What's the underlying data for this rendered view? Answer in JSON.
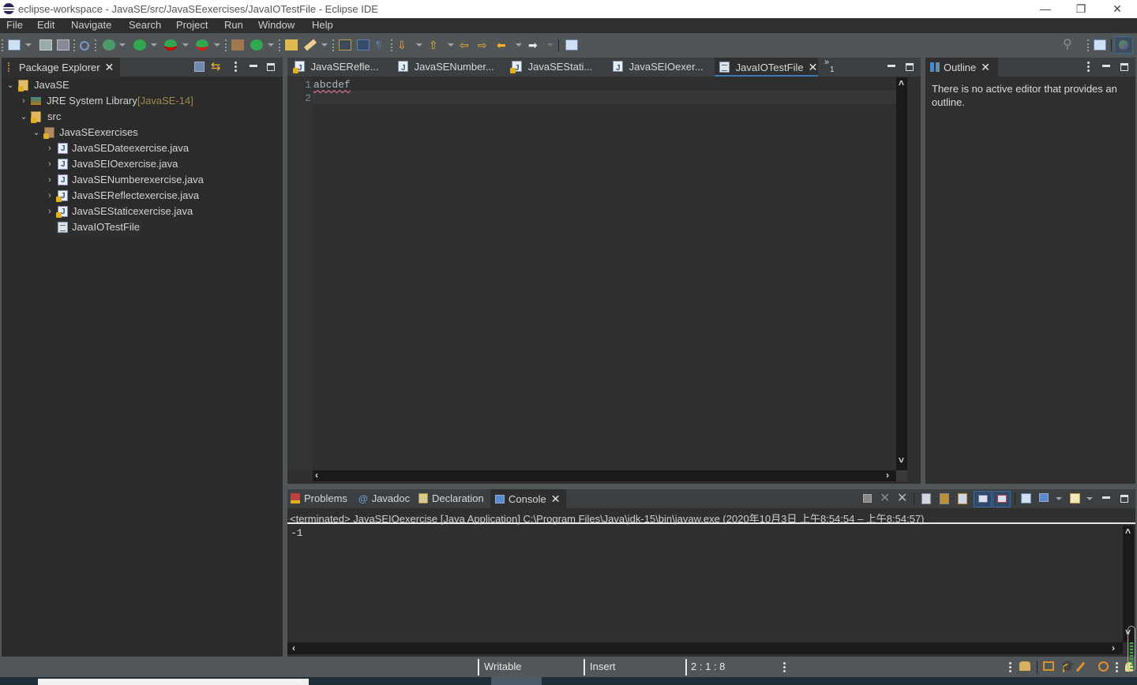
{
  "window": {
    "title": "eclipse-workspace - JavaSE/src/JavaSEexercises/JavaIOTestFile - Eclipse IDE",
    "minimize_glyph": "—",
    "restore_glyph": "❐",
    "close_glyph": "✕"
  },
  "menu": {
    "items": [
      "File",
      "Edit",
      "Navigate",
      "Search",
      "Project",
      "Run",
      "Window",
      "Help"
    ]
  },
  "toolbar": {
    "icons": [
      "new-icon",
      "save-icon",
      "save-all-icon",
      "skip-breakpoints-icon",
      "debug-icon",
      "run-icon",
      "coverage-icon",
      "external-tools-icon",
      "new-java-package-icon",
      "new-java-class-icon",
      "open-type-icon",
      "search-pencil-icon",
      "toggle-mark-occurrences-icon",
      "toggle-block-selection-icon",
      "show-whitespace-icon",
      "next-annotation-icon",
      "previous-annotation-icon",
      "last-edit-location-icon",
      "back-icon",
      "forward-icon",
      "pin-editor-icon"
    ],
    "right_icons": [
      "search-icon",
      "open-perspective-icon",
      "java-ee-perspective-icon"
    ]
  },
  "package_explorer": {
    "tab_label": "Package Explorer",
    "tree": [
      {
        "label": "JavaSE",
        "depth": 0,
        "expanded": true,
        "icon": "project-icon"
      },
      {
        "label": "JRE System Library",
        "suffix": "[JavaSE-14]",
        "depth": 1,
        "expanded": false,
        "icon": "library-icon"
      },
      {
        "label": "src",
        "depth": 1,
        "expanded": true,
        "icon": "source-folder-icon"
      },
      {
        "label": "JavaSEexercises",
        "depth": 2,
        "expanded": true,
        "icon": "package-icon"
      },
      {
        "label": "JavaSEDateexercise.java",
        "depth": 3,
        "expanded": false,
        "icon": "java-file-icon",
        "warning": false
      },
      {
        "label": "JavaSEIOexercise.java",
        "depth": 3,
        "expanded": false,
        "icon": "java-file-icon",
        "warning": false
      },
      {
        "label": "JavaSENumberexercise.java",
        "depth": 3,
        "expanded": false,
        "icon": "java-file-icon",
        "warning": false
      },
      {
        "label": "JavaSEReflectexercise.java",
        "depth": 3,
        "expanded": false,
        "icon": "java-file-icon",
        "warning": true
      },
      {
        "label": "JavaSEStaticexercise.java",
        "depth": 3,
        "expanded": false,
        "icon": "java-file-icon",
        "warning": true
      },
      {
        "label": "JavaIOTestFile",
        "depth": 3,
        "leaf": true,
        "icon": "text-file-icon"
      }
    ]
  },
  "editor": {
    "tabs": [
      {
        "label": "JavaSERefle...",
        "icon": "java-file-icon",
        "warning": true,
        "active": false
      },
      {
        "label": "JavaSENumber...",
        "icon": "java-file-icon",
        "warning": false,
        "active": false
      },
      {
        "label": "JavaSEStati...",
        "icon": "java-file-icon",
        "warning": true,
        "active": false
      },
      {
        "label": "JavaSEIOexer...",
        "icon": "java-file-icon",
        "warning": false,
        "active": false
      },
      {
        "label": "JavaIOTestFile",
        "icon": "text-file-icon",
        "active": true
      }
    ],
    "overflow": {
      "glyph": "»",
      "count": "1"
    },
    "lines": [
      {
        "number": "1",
        "text": "abcdef"
      },
      {
        "number": "2",
        "text": ""
      }
    ]
  },
  "outline": {
    "tab_label": "Outline",
    "message": "There is no active editor that provides an outline."
  },
  "bottom": {
    "tabs": [
      {
        "label": "Problems",
        "icon": "problems-icon",
        "active": false
      },
      {
        "label": "Javadoc",
        "icon": "javadoc-icon",
        "active": false
      },
      {
        "label": "Declaration",
        "icon": "declaration-icon",
        "active": false
      },
      {
        "label": "Console",
        "icon": "console-icon",
        "active": true
      }
    ],
    "toolbar_icons": [
      "terminate-icon",
      "remove-launch-icon",
      "remove-all-terminated-icon",
      "clear-console-icon",
      "scroll-lock-icon",
      "word-wrap-icon",
      "show-on-stdout-icon",
      "show-on-stderr-icon",
      "pin-console-icon",
      "display-console-icon",
      "open-console-icon"
    ],
    "console_header": "<terminated> JavaSEIOexercise [Java Application] C:\\Program Files\\Java\\jdk-15\\bin\\javaw.exe  (2020年10月3日 上午8:54:54 – 上午8:54:57)",
    "console_output": "-1"
  },
  "status": {
    "writable": "Writable",
    "insert_mode": "Insert",
    "position": "2 : 1 : 8"
  }
}
